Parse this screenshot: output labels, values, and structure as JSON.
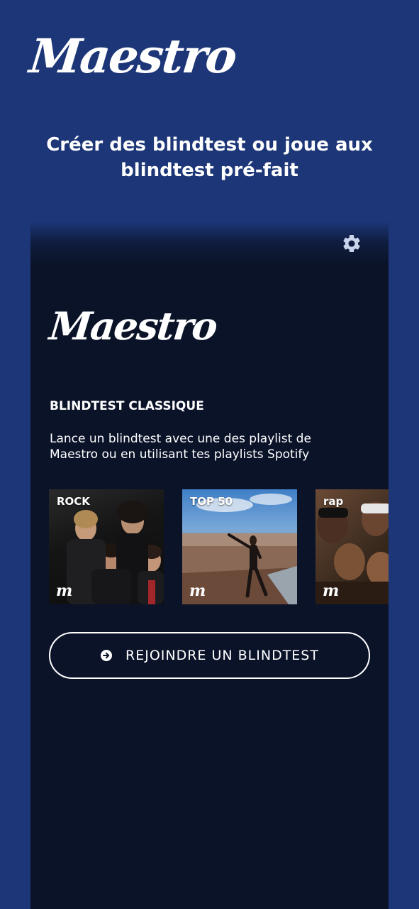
{
  "promo": {
    "logo": "Maestro",
    "heading": "Créer des blindtest ou joue aux blindtest pré-fait"
  },
  "app": {
    "logo": "Maestro",
    "section_title": "BLINDTEST CLASSIQUE",
    "section_description": "Lance un blindtest avec une des playlist de Maestro ou en utilisant tes playlists Spotify",
    "playlists": [
      {
        "label": "ROCK",
        "mark": "m"
      },
      {
        "label": "TOP 50",
        "mark": "m"
      },
      {
        "label": "rap",
        "mark": "m"
      }
    ],
    "join_button_label": "REJOINDRE UN BLINDTEST"
  },
  "icons": {
    "settings": "gear-icon",
    "join": "arrow-circle-right-icon"
  },
  "colors": {
    "background": "#1c3677",
    "app_background": "#0b1329",
    "text": "#ffffff",
    "settings_icon": "#c9d3ea"
  }
}
